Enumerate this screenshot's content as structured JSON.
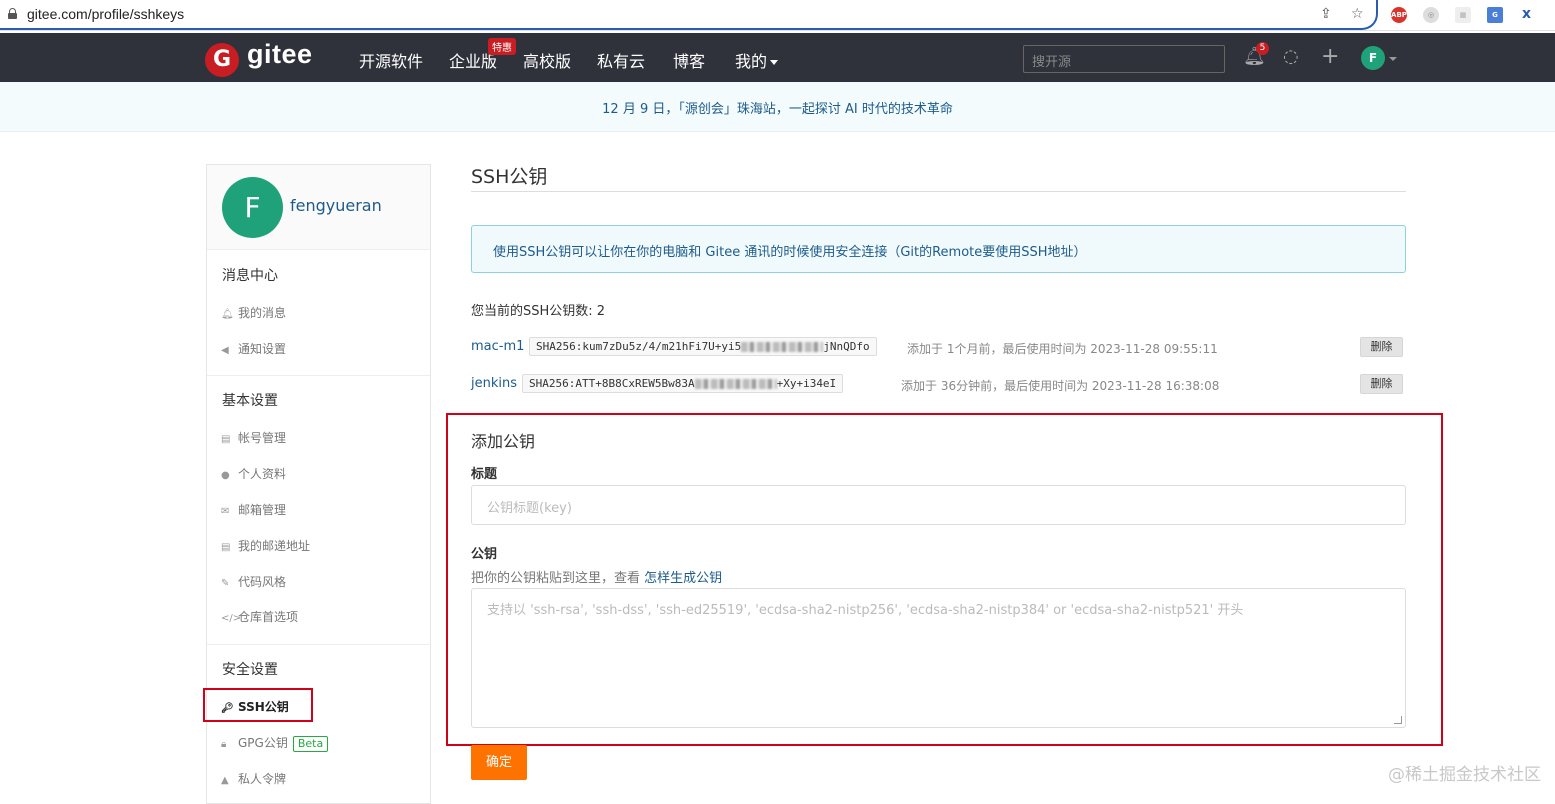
{
  "browser": {
    "url": "gitee.com/profile/sshkeys",
    "ext_abp": "ABP"
  },
  "header": {
    "logo_letter": "G",
    "logo_text": "gitee",
    "nav": [
      "开源软件",
      "企业版",
      "高校版",
      "私有云",
      "博客",
      "我的"
    ],
    "nav_tag": "特惠",
    "search_placeholder": "搜开源",
    "notification_count": "5",
    "avatar_letter": "F"
  },
  "announcement": "12 月 9 日，「源创会」珠海站，一起探讨 AI 时代的技术革命",
  "sidebar": {
    "avatar_letter": "F",
    "username": "fengyueran",
    "sections": {
      "messages": {
        "title": "消息中心",
        "items": [
          "我的消息",
          "通知设置"
        ]
      },
      "basic": {
        "title": "基本设置",
        "items": [
          "帐号管理",
          "个人资料",
          "邮箱管理",
          "我的邮递地址",
          "代码风格",
          "仓库首选项"
        ]
      },
      "security": {
        "title": "安全设置",
        "items": [
          "SSH公钥",
          "GPG公钥",
          "私人令牌"
        ],
        "beta": "Beta"
      }
    }
  },
  "main": {
    "title": "SSH公钥",
    "info": "使用SSH公钥可以让你在你的电脑和 Gitee 通讯的时候使用安全连接（Git的Remote要使用SSH地址）",
    "count_label": "您当前的SSH公钥数: 2",
    "keys": [
      {
        "name": "mac-m1",
        "fp_start": "SHA256:kum7zDu5z/4/m21hFi7U+yi5",
        "fp_end": "jNnQDfo",
        "meta": "添加于 1个月前，最后使用时间为 2023-11-28 09:55:11",
        "delete": "删除"
      },
      {
        "name": "jenkins",
        "fp_start": "SHA256:ATT+8B8CxREW5Bw83A",
        "fp_end": "+Xy+i34eI",
        "meta": "添加于 36分钟前，最后使用时间为 2023-11-28 16:38:08",
        "delete": "删除"
      }
    ],
    "add": {
      "title": "添加公钥",
      "title_label": "标题",
      "title_placeholder": "公钥标题(key)",
      "key_label": "公钥",
      "hint_prefix": "把你的公钥粘贴到这里，查看",
      "hint_link": "怎样生成公钥",
      "key_placeholder": "支持以 'ssh-rsa', 'ssh-dss', 'ssh-ed25519', 'ecdsa-sha2-nistp256', 'ecdsa-sha2-nistp384' or 'ecdsa-sha2-nistp521' 开头",
      "submit": "确定"
    }
  },
  "watermark": "@稀土掘金技术社区"
}
